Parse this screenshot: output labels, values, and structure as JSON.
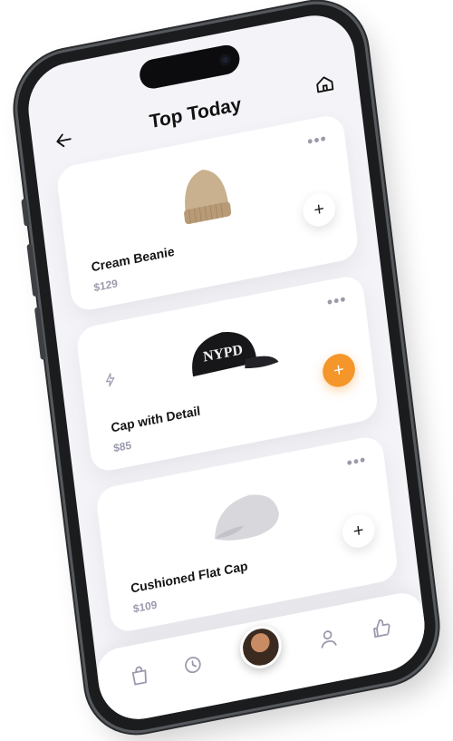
{
  "header": {
    "title": "Top Today"
  },
  "products": [
    {
      "name": "Cream Beanie",
      "price": "$129",
      "image": "beanie-hat",
      "add_button": "+",
      "accent": false
    },
    {
      "name": "Cap with Detail",
      "price": "$85",
      "image": "nypd-cap",
      "image_text": "NYPD",
      "add_button": "+",
      "accent": true
    },
    {
      "name": "Cushioned Flat Cap",
      "price": "$109",
      "image": "flat-cap",
      "add_button": "+",
      "accent": false
    }
  ],
  "more_label": "•••",
  "tabbar": {
    "items": [
      "bag-icon",
      "history-icon",
      "profile-avatar",
      "user-icon",
      "like-icon"
    ]
  },
  "colors": {
    "accent": "#f4962a",
    "screen_bg": "#f4f4f8",
    "card_bg": "#ffffff",
    "price": "#9a9aae"
  }
}
